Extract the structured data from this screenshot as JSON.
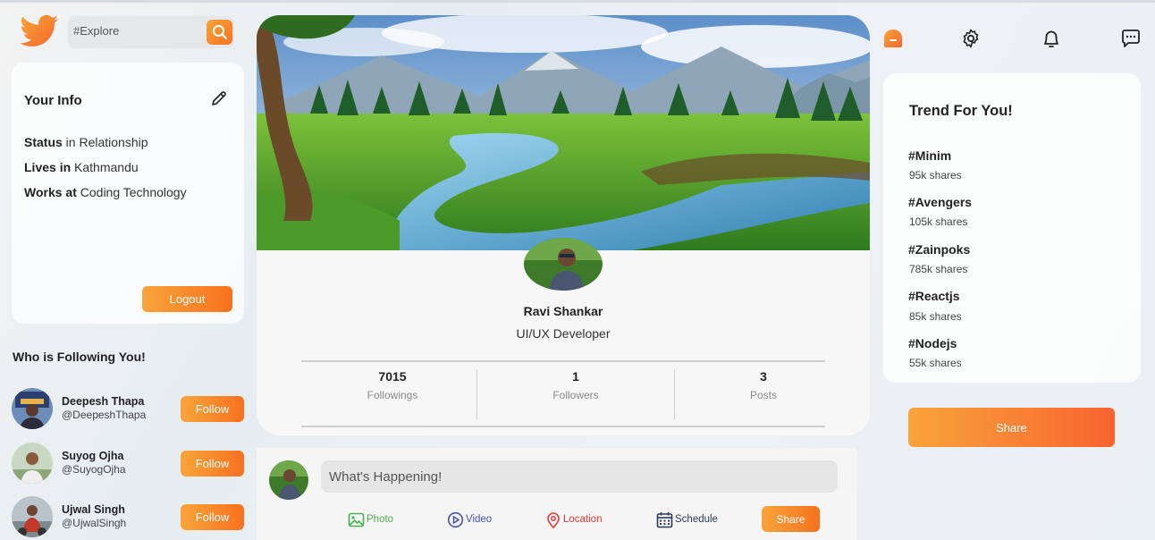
{
  "header": {
    "logo_icon": "twitter-bird-icon",
    "search_placeholder": "#Explore",
    "search_icon": "search-icon"
  },
  "info": {
    "title": "Your Info",
    "edit_icon": "pencil-icon",
    "rows": [
      {
        "label": "Status",
        "value": " in Relationship"
      },
      {
        "label": "Lives in",
        "value": " Kathmandu"
      },
      {
        "label": "Works at",
        "value": " Coding Technology"
      }
    ],
    "logout_label": "Logout"
  },
  "followers": {
    "title": "Who is Following You!",
    "items": [
      {
        "name": "Deepesh Thapa",
        "handle": "@DeepeshThapa",
        "button": "Follow"
      },
      {
        "name": "Suyog Ojha",
        "handle": "@SuyogOjha",
        "button": "Follow"
      },
      {
        "name": "Ujwal Singh",
        "handle": "@UjwalSingh",
        "button": "Follow"
      }
    ]
  },
  "profile": {
    "name": "Ravi Shankar",
    "role": "UI/UX Developer",
    "stats": [
      {
        "value": "7015",
        "label": "Followings"
      },
      {
        "value": "1",
        "label": "Followers"
      },
      {
        "value": "3",
        "label": "Posts"
      }
    ]
  },
  "post": {
    "placeholder": "What's Happening!",
    "options": [
      {
        "label": "Photo",
        "icon": "photo-icon",
        "color": "#4caf50"
      },
      {
        "label": "Video",
        "icon": "video-play-icon",
        "color": "#4a4fb3"
      },
      {
        "label": "Location",
        "icon": "location-pin-icon",
        "color": "#e53935"
      },
      {
        "label": "Schedule",
        "icon": "calendar-icon",
        "color": "#2b3a55"
      }
    ],
    "share_label": "Share"
  },
  "nav": {
    "icons": [
      "home-icon",
      "settings-gear-icon",
      "bell-icon",
      "chat-icon"
    ]
  },
  "trends": {
    "title": "Trend For You!",
    "items": [
      {
        "tag": "#Minim",
        "shares": "95k shares"
      },
      {
        "tag": "#Avengers",
        "shares": "105k shares"
      },
      {
        "tag": "#Zainpoks",
        "shares": "785k shares"
      },
      {
        "tag": "#Reactjs",
        "shares": "85k shares"
      },
      {
        "tag": "#Nodejs",
        "shares": "55k shares"
      }
    ],
    "share_label": "Share"
  },
  "colors": {
    "accent_start": "#f9a43b",
    "accent_end": "#f7711f"
  }
}
